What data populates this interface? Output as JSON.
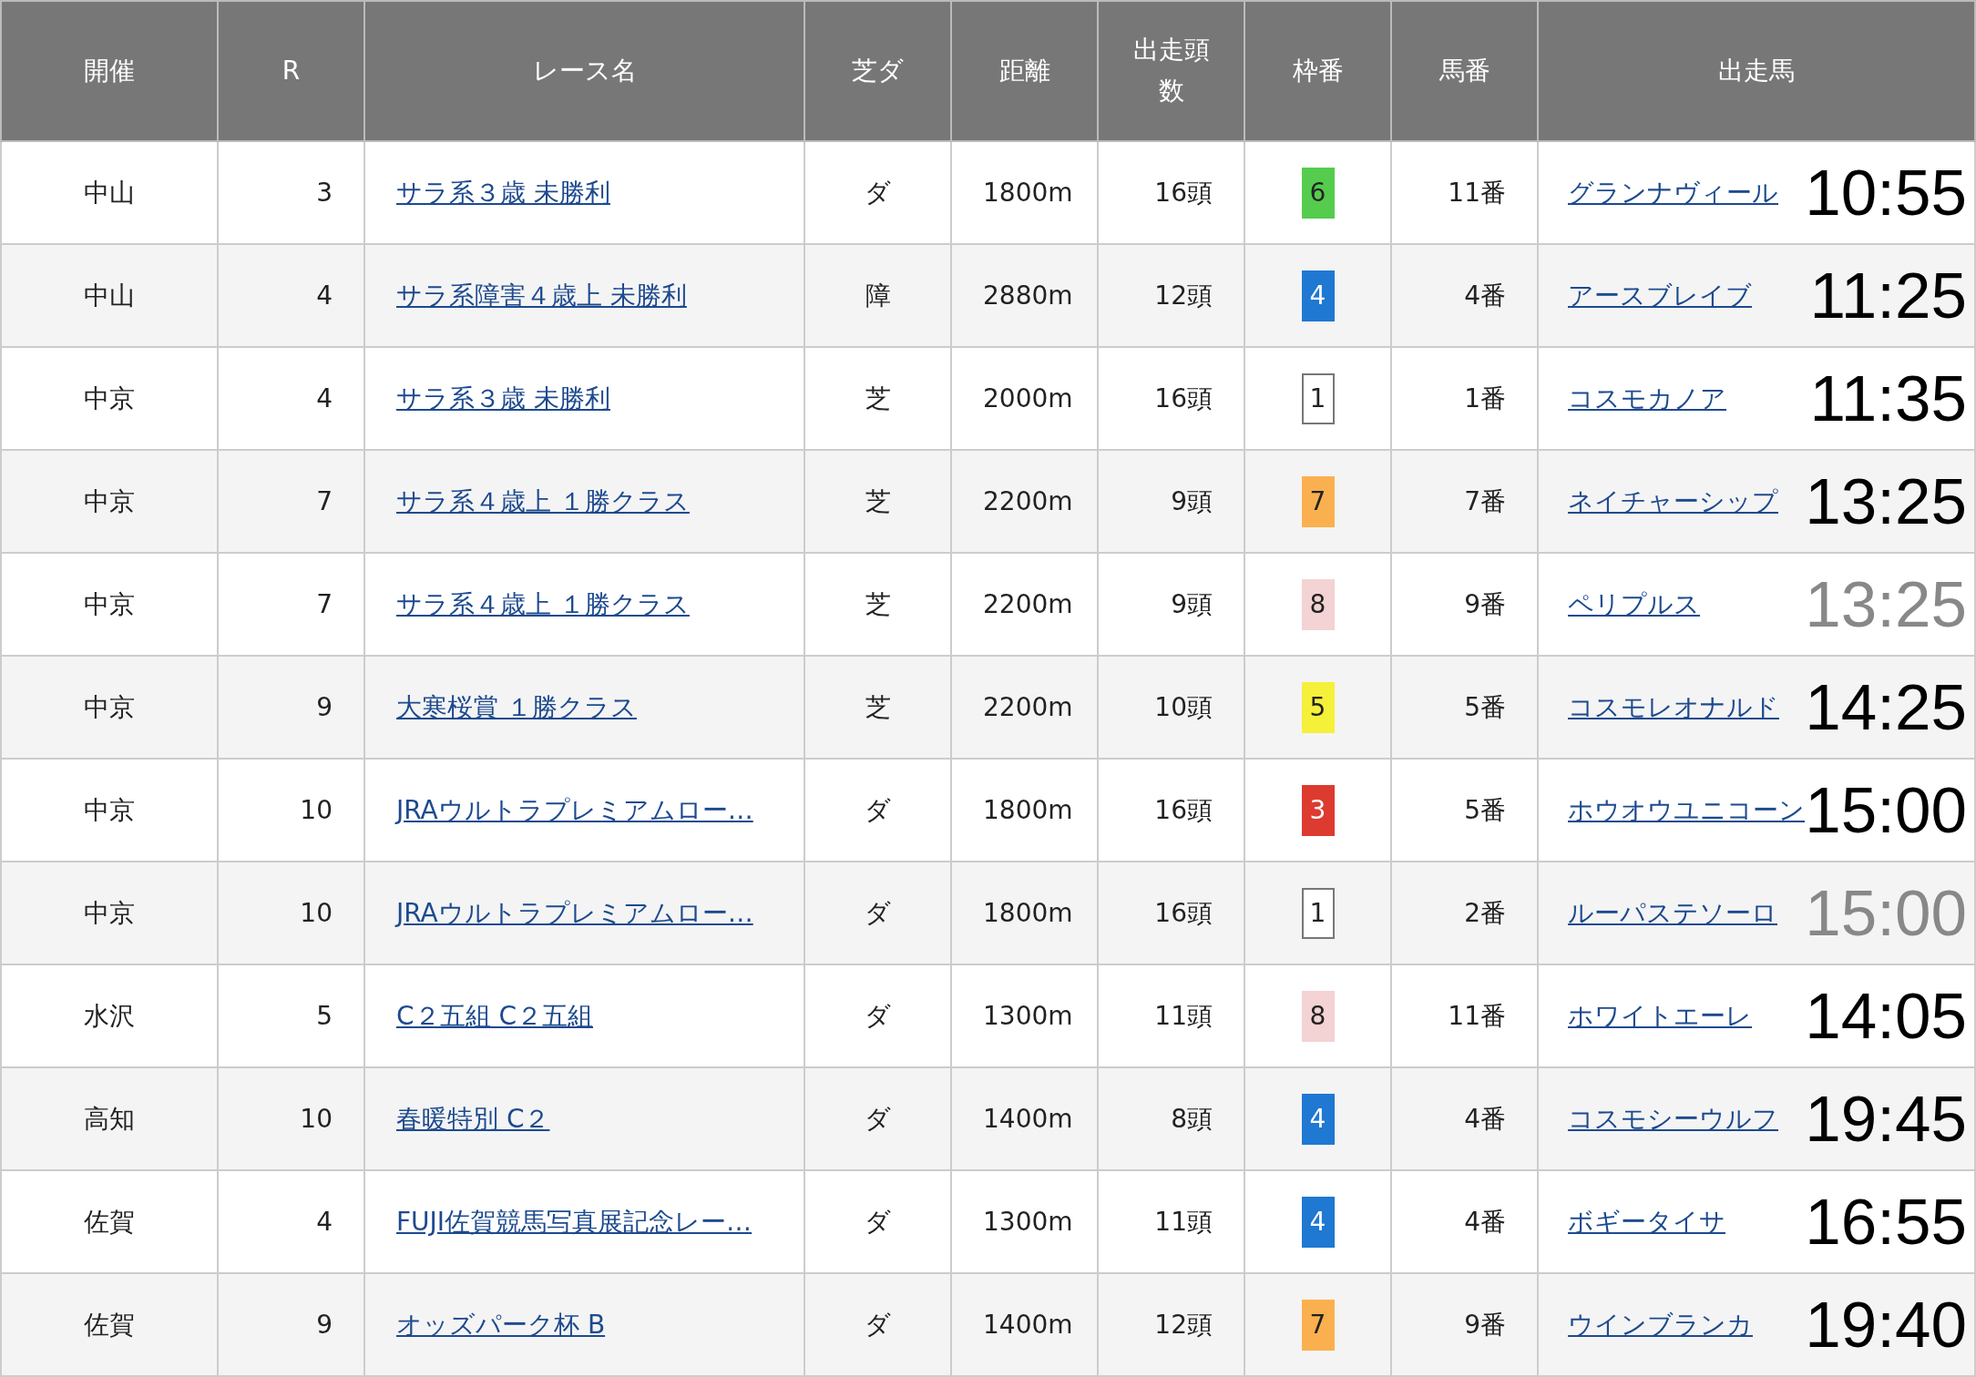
{
  "table": {
    "columns": [
      "開催",
      "R",
      "レース名",
      "芝ダ",
      "距離",
      "出走頭数",
      "枠番",
      "馬番",
      "出走馬"
    ],
    "rows": [
      {
        "venue": "中山",
        "race": "3",
        "race_name": "サラ系３歳 未勝利",
        "surface": "ダ",
        "distance": "1800m",
        "runners": "16頭",
        "frame": "6",
        "color": "#55cc4d",
        "horse_no": "11番",
        "horse": "グランナヴィール",
        "time": "10:55",
        "dim": false
      },
      {
        "venue": "中山",
        "race": "4",
        "race_name": "サラ系障害４歳上 未勝利",
        "surface": "障",
        "distance": "2880m",
        "runners": "12頭",
        "frame": "4",
        "color": "#1f78d1",
        "horse_no": "4番",
        "horse": "アースブレイブ",
        "time": "11:25",
        "dim": false
      },
      {
        "venue": "中京",
        "race": "4",
        "race_name": "サラ系３歳 未勝利",
        "surface": "芝",
        "distance": "2000m",
        "runners": "16頭",
        "frame": "1",
        "color": "#ffffff",
        "horse_no": "1番",
        "horse": "コスモカノア",
        "time": "11:35",
        "dim": false
      },
      {
        "venue": "中京",
        "race": "7",
        "race_name": "サラ系４歳上 １勝クラス",
        "surface": "芝",
        "distance": "2200m",
        "runners": "9頭",
        "frame": "7",
        "color": "#fbb04f",
        "horse_no": "7番",
        "horse": "ネイチャーシップ",
        "time": "13:25",
        "dim": false
      },
      {
        "venue": "中京",
        "race": "7",
        "race_name": "サラ系４歳上 １勝クラス",
        "surface": "芝",
        "distance": "2200m",
        "runners": "9頭",
        "frame": "8",
        "color": "#f3d3d3",
        "horse_no": "9番",
        "horse": "ペリプルス",
        "time": "13:25",
        "dim": true
      },
      {
        "venue": "中京",
        "race": "9",
        "race_name": "大寒桜賞 １勝クラス",
        "surface": "芝",
        "distance": "2200m",
        "runners": "10頭",
        "frame": "5",
        "color": "#f5f03a",
        "horse_no": "5番",
        "horse": "コスモレオナルド",
        "time": "14:25",
        "dim": false
      },
      {
        "venue": "中京",
        "race": "10",
        "race_name": "JRAウルトラプレミアムロー…",
        "surface": "ダ",
        "distance": "1800m",
        "runners": "16頭",
        "frame": "3",
        "color": "#dd3a30",
        "horse_no": "5番",
        "horse": "ホウオウユニコーン",
        "time": "15:00",
        "dim": false
      },
      {
        "venue": "中京",
        "race": "10",
        "race_name": "JRAウルトラプレミアムロー…",
        "surface": "ダ",
        "distance": "1800m",
        "runners": "16頭",
        "frame": "1",
        "color": "#ffffff",
        "horse_no": "2番",
        "horse": "ルーパステソーロ",
        "time": "15:00",
        "dim": true
      },
      {
        "venue": "水沢",
        "race": "5",
        "race_name": "C２五組 C２五組",
        "surface": "ダ",
        "distance": "1300m",
        "runners": "11頭",
        "frame": "8",
        "color": "#f3d3d3",
        "horse_no": "11番",
        "horse": "ホワイトエーレ",
        "time": "14:05",
        "dim": false
      },
      {
        "venue": "高知",
        "race": "10",
        "race_name": "春暖特別 C２",
        "surface": "ダ",
        "distance": "1400m",
        "runners": "8頭",
        "frame": "4",
        "color": "#1f78d1",
        "horse_no": "4番",
        "horse": "コスモシーウルフ",
        "time": "19:45",
        "dim": false
      },
      {
        "venue": "佐賀",
        "race": "4",
        "race_name": "FUJI佐賀競馬写真展記念レー…",
        "surface": "ダ",
        "distance": "1300m",
        "runners": "11頭",
        "frame": "4",
        "color": "#1f78d1",
        "horse_no": "4番",
        "horse": "ボギータイサ",
        "time": "16:55",
        "dim": false
      },
      {
        "venue": "佐賀",
        "race": "9",
        "race_name": "オッズパーク杯 B",
        "surface": "ダ",
        "distance": "1400m",
        "runners": "12頭",
        "frame": "7",
        "color": "#fbb04f",
        "horse_no": "9番",
        "horse": "ウインブランカ",
        "time": "19:40",
        "dim": false
      }
    ]
  }
}
